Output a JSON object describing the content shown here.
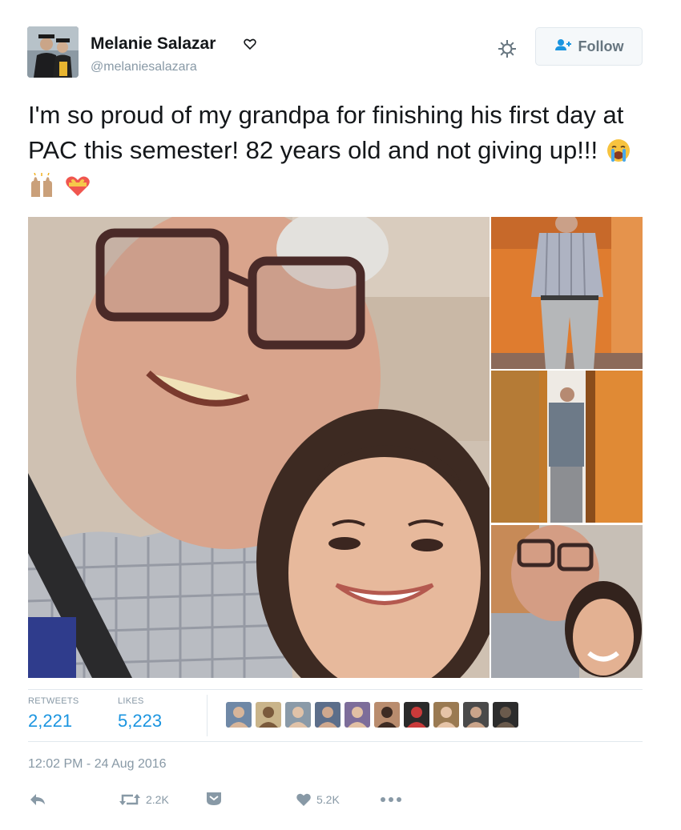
{
  "user": {
    "name": "Melanie Salazar",
    "handle": "@melaniesalazara",
    "verified_icon": "heart-outline-icon"
  },
  "header": {
    "follow_label": "Follow",
    "gear_icon": "gear-icon"
  },
  "tweet": {
    "text": "I'm so proud of my grandpa for finishing his first day at PAC this semester! 82 years old and not giving up!!!",
    "emojis": [
      "loudly-crying-face-icon",
      "raising-hands-icon",
      "heart-with-ribbon-icon"
    ]
  },
  "stats": {
    "retweets_label": "RETWEETS",
    "retweets_value": "2,221",
    "likes_label": "LIKES",
    "likes_value": "5,223",
    "liker_count": 10
  },
  "timestamp": "12:02 PM - 24 Aug 2016",
  "actions": {
    "retweet_count": "2.2K",
    "like_count": "5.2K"
  },
  "colors": {
    "accent": "#1b95e0",
    "muted": "#8899a6",
    "border": "#e1e8ed"
  }
}
